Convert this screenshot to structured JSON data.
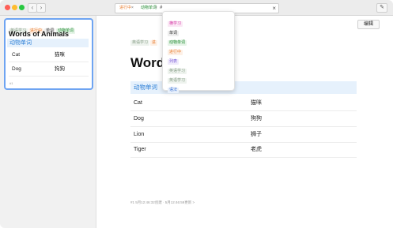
{
  "titlebar": {
    "search_chips": [
      {
        "label": "进行中",
        "color": "#e87a2a"
      },
      {
        "label": "动物单词",
        "color": "#1e8a2e"
      }
    ],
    "chip_close": "×",
    "search_query": "#",
    "clear_label": "×",
    "back_label": "‹",
    "forward_label": "›",
    "compose_label": "✎"
  },
  "dropdown": {
    "items": [
      {
        "label": "横学习",
        "style": "pink"
      },
      {
        "label": "单词",
        "style": "dark"
      },
      {
        "label": "动物单词",
        "style": "green"
      },
      {
        "label": "进行中",
        "style": "orange"
      },
      {
        "label": "列表",
        "style": "purple"
      },
      {
        "label": "英语学习",
        "style": "gray"
      },
      {
        "label": "英语学习",
        "style": "gray"
      },
      {
        "label": "语法",
        "style": "blue"
      }
    ]
  },
  "sidebar": {
    "card": {
      "tags": [
        "英语学习",
        "进行中",
        "单词",
        "动物单词"
      ],
      "title": "Words of Animals",
      "subtitle": "动物单词",
      "rows": [
        {
          "word": "Cat",
          "meaning": "猫咪"
        },
        {
          "word": "Dog",
          "meaning": "狗狗"
        }
      ],
      "footer": "#1"
    }
  },
  "main": {
    "edit_label": "编辑",
    "tags": [
      "英语学习",
      "进"
    ],
    "title": "Words",
    "subtitle": "动物单词",
    "rows": [
      {
        "word": "Cat",
        "meaning": "猫咪"
      },
      {
        "word": "Dog",
        "meaning": "狗狗"
      },
      {
        "word": "Lion",
        "meaning": "狮子"
      },
      {
        "word": "Tiger",
        "meaning": "老虎"
      }
    ],
    "footer": "#1  5月12:46:32创建 · 5月12:46:59更新 >"
  }
}
